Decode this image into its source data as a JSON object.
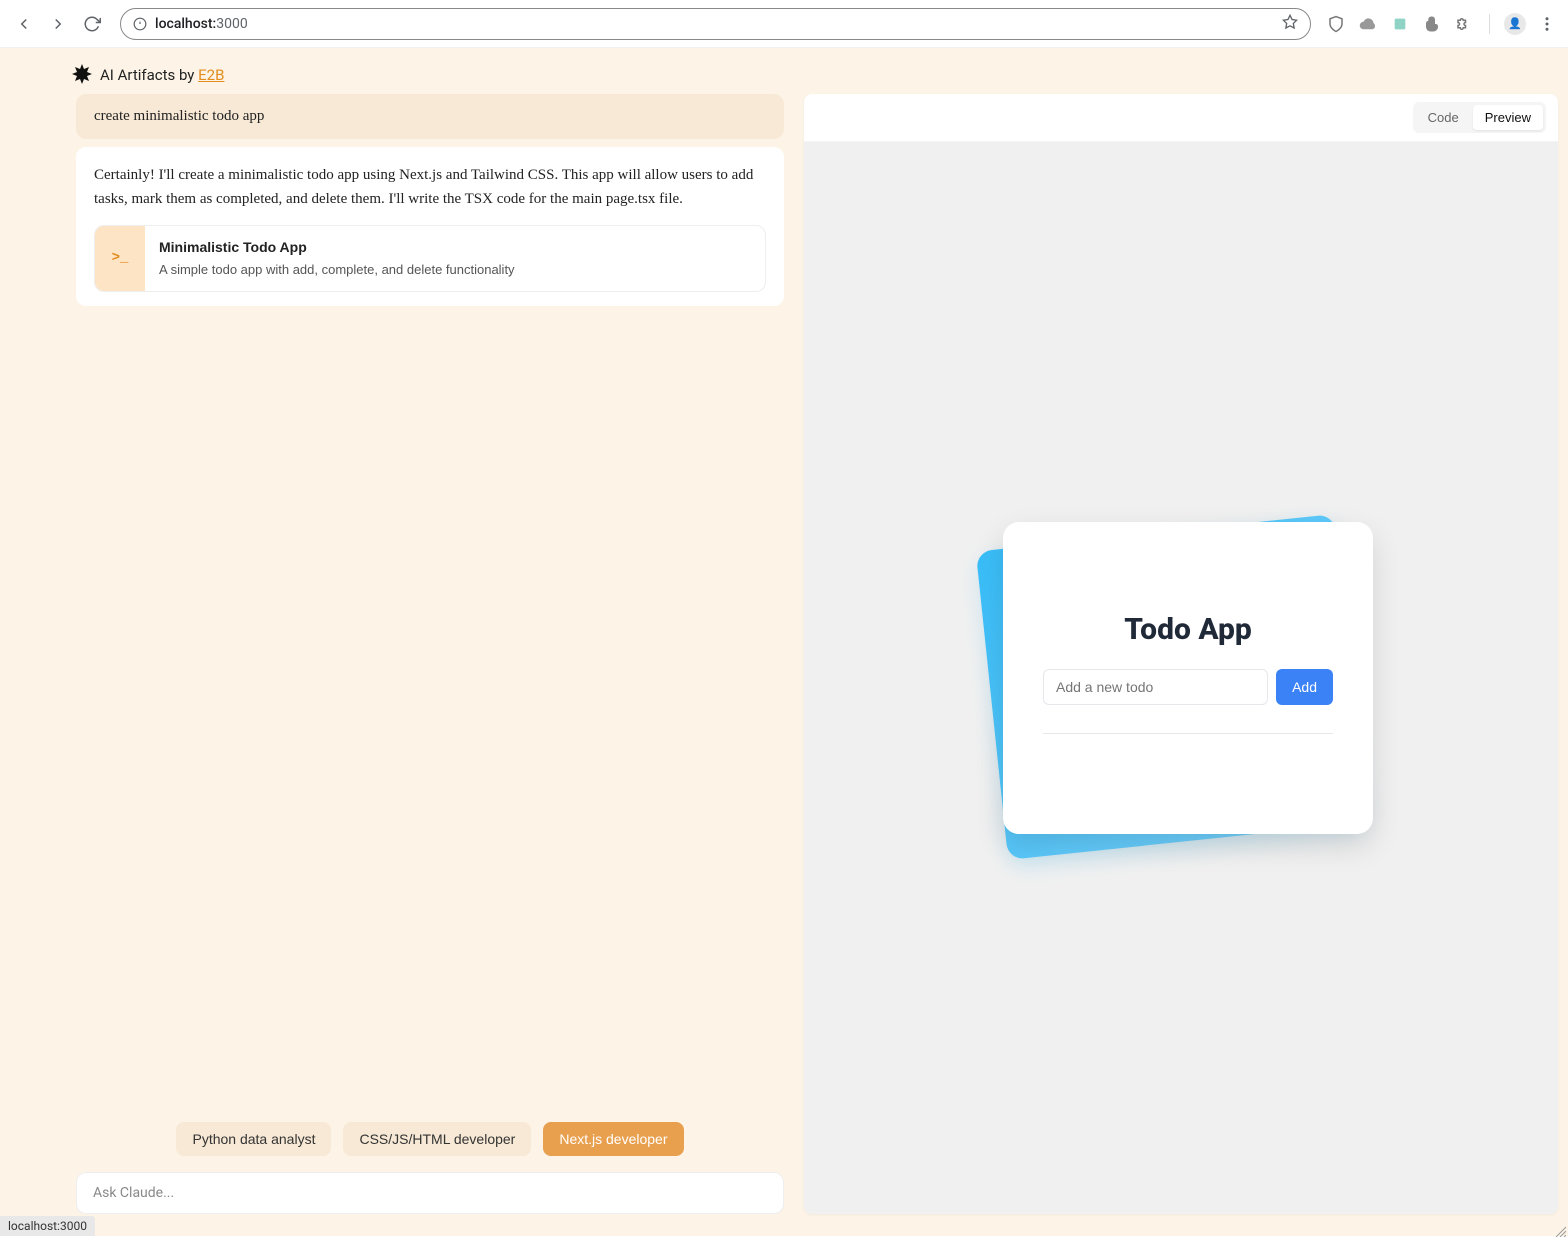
{
  "browser": {
    "address_host": "localhost:",
    "address_port": "3000"
  },
  "header": {
    "prefix": "AI Artifacts by ",
    "link": "E2B"
  },
  "chat": {
    "user_message": "create minimalistic todo app",
    "assistant_message": "Certainly! I'll create a minimalistic todo app using Next.js and Tailwind CSS. This app will allow users to add tasks, mark them as completed, and delete them. I'll write the TSX code for the main page.tsx file.",
    "artifact": {
      "icon": ">_",
      "title": "Minimalistic Todo App",
      "description": "A simple todo app with add, complete, and delete functionality"
    }
  },
  "personas": [
    {
      "label": "Python data analyst",
      "active": false
    },
    {
      "label": "CSS/JS/HTML developer",
      "active": false
    },
    {
      "label": "Next.js developer",
      "active": true
    }
  ],
  "prompt_placeholder": "Ask Claude...",
  "preview": {
    "tabs": {
      "code": "Code",
      "preview": "Preview"
    },
    "todo": {
      "title": "Todo App",
      "input_placeholder": "Add a new todo",
      "add_button": "Add"
    }
  },
  "status_bar": "localhost:3000"
}
